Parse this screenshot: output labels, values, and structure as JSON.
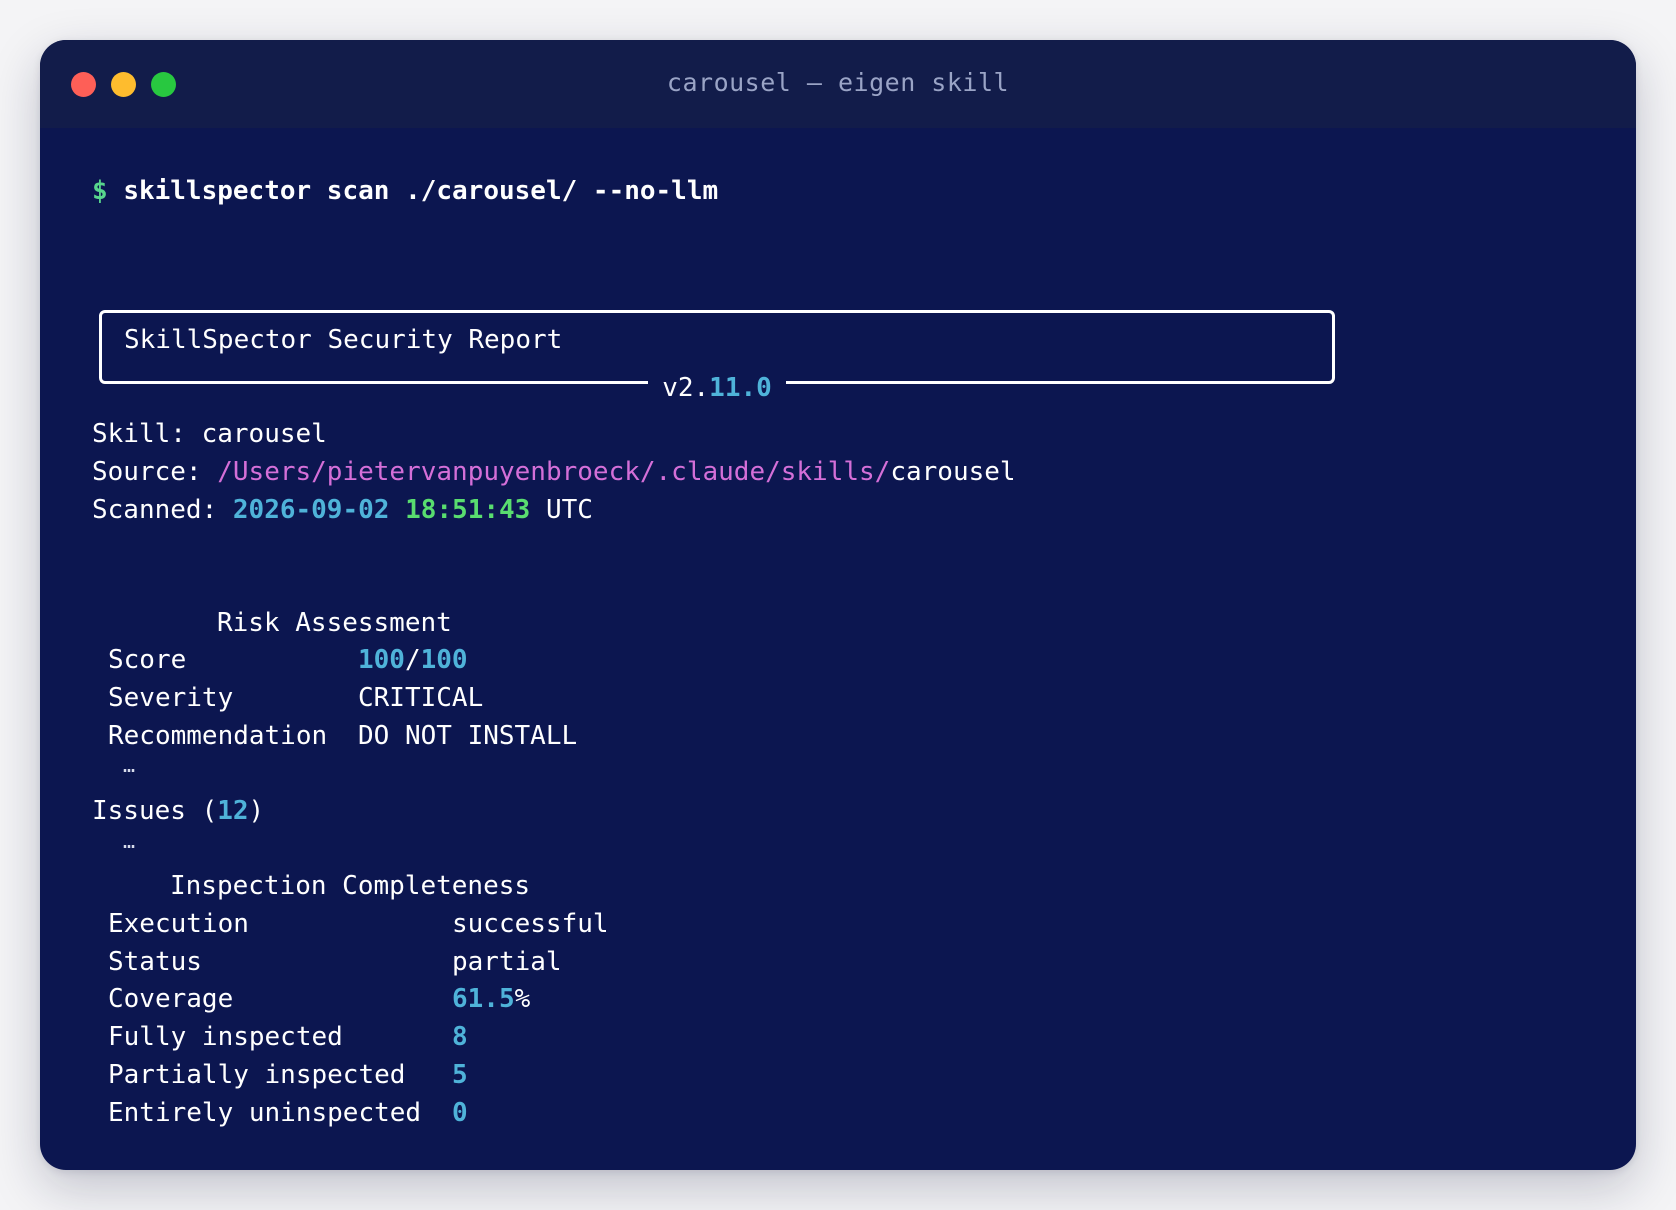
{
  "window": {
    "title": "carousel — eigen skill"
  },
  "command": {
    "prompt": "$",
    "text": "skillspector scan ./carousel/ --no-llm"
  },
  "panel": {
    "title": "SkillSpector Security Report",
    "version_prefix": "v2.",
    "version_suffix": "11.0"
  },
  "meta": {
    "skill_label": "Skill:",
    "skill_value": "carousel",
    "source_label": "Source:",
    "source_path": "/Users/pietervanpuyenbroeck/.claude/skills/",
    "source_name": "carousel",
    "scanned_label": "Scanned:",
    "scanned_date": "2026-09-02",
    "scanned_time": "18:51:43",
    "scanned_tz": "UTC"
  },
  "risk": {
    "heading": "Risk Assessment",
    "score_label": "Score",
    "score_value": "100",
    "score_sep": "/",
    "score_max": "100",
    "severity_label": "Severity",
    "severity_value": "CRITICAL",
    "recommendation_label": "Recommendation",
    "recommendation_value": "DO NOT INSTALL",
    "ellipsis": "…"
  },
  "issues": {
    "label": "Issues (",
    "count": "12",
    "close": ")",
    "ellipsis": "…"
  },
  "inspection": {
    "heading": "Inspection Completeness",
    "execution_label": "Execution",
    "execution_value": "successful",
    "status_label": "Status",
    "status_value": "partial",
    "coverage_label": "Coverage",
    "coverage_value": "61.5",
    "coverage_unit": "%",
    "fully_label": "Fully inspected",
    "fully_value": "8",
    "partially_label": "Partially inspected",
    "partially_value": "5",
    "uninspected_label": "Entirely uninspected",
    "uninspected_value": "0"
  },
  "colors": {
    "background": "#0c1650",
    "titlebar": "#121c4a",
    "prompt": "#58d68d",
    "number": "#4fb3d9",
    "time": "#59dd6f",
    "path": "#d46fd8"
  }
}
